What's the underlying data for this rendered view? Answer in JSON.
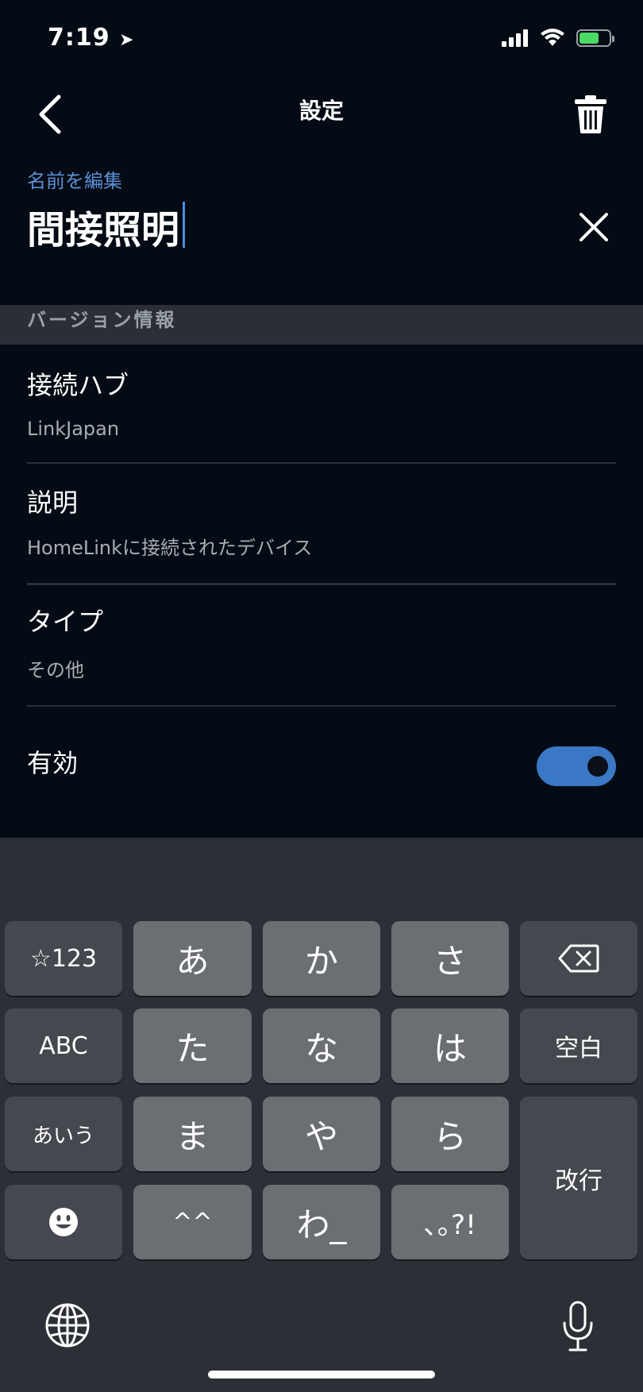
{
  "status_bar": {
    "time": "7:19"
  },
  "header": {
    "title": "設定"
  },
  "name_edit": {
    "label": "名前を編集",
    "value": "間接照明"
  },
  "section": {
    "title": "バージョン情報"
  },
  "rows": [
    {
      "title": "接続ハブ",
      "value": "LinkJapan"
    },
    {
      "title": "説明",
      "value": "HomeLinkに接続されたデバイス"
    },
    {
      "title": "タイプ",
      "value": "その他"
    }
  ],
  "enabled": {
    "label": "有効",
    "on": true,
    "accent": "#3a78c6"
  },
  "keyboard": {
    "row1": [
      "☆123",
      "あ",
      "か",
      "さ"
    ],
    "row2": [
      "ABC",
      "た",
      "な",
      "は",
      "空白"
    ],
    "row3": [
      "あいう",
      "ま",
      "や",
      "ら",
      "改行"
    ],
    "row4": [
      "^^",
      "わ_",
      "､｡?!"
    ]
  },
  "icons": {
    "back": "chevron-left-icon",
    "trash": "trash-icon",
    "clear": "close-icon",
    "delete": "backspace-icon",
    "emoji": "emoji-icon",
    "globe": "globe-icon",
    "mic": "microphone-icon"
  }
}
